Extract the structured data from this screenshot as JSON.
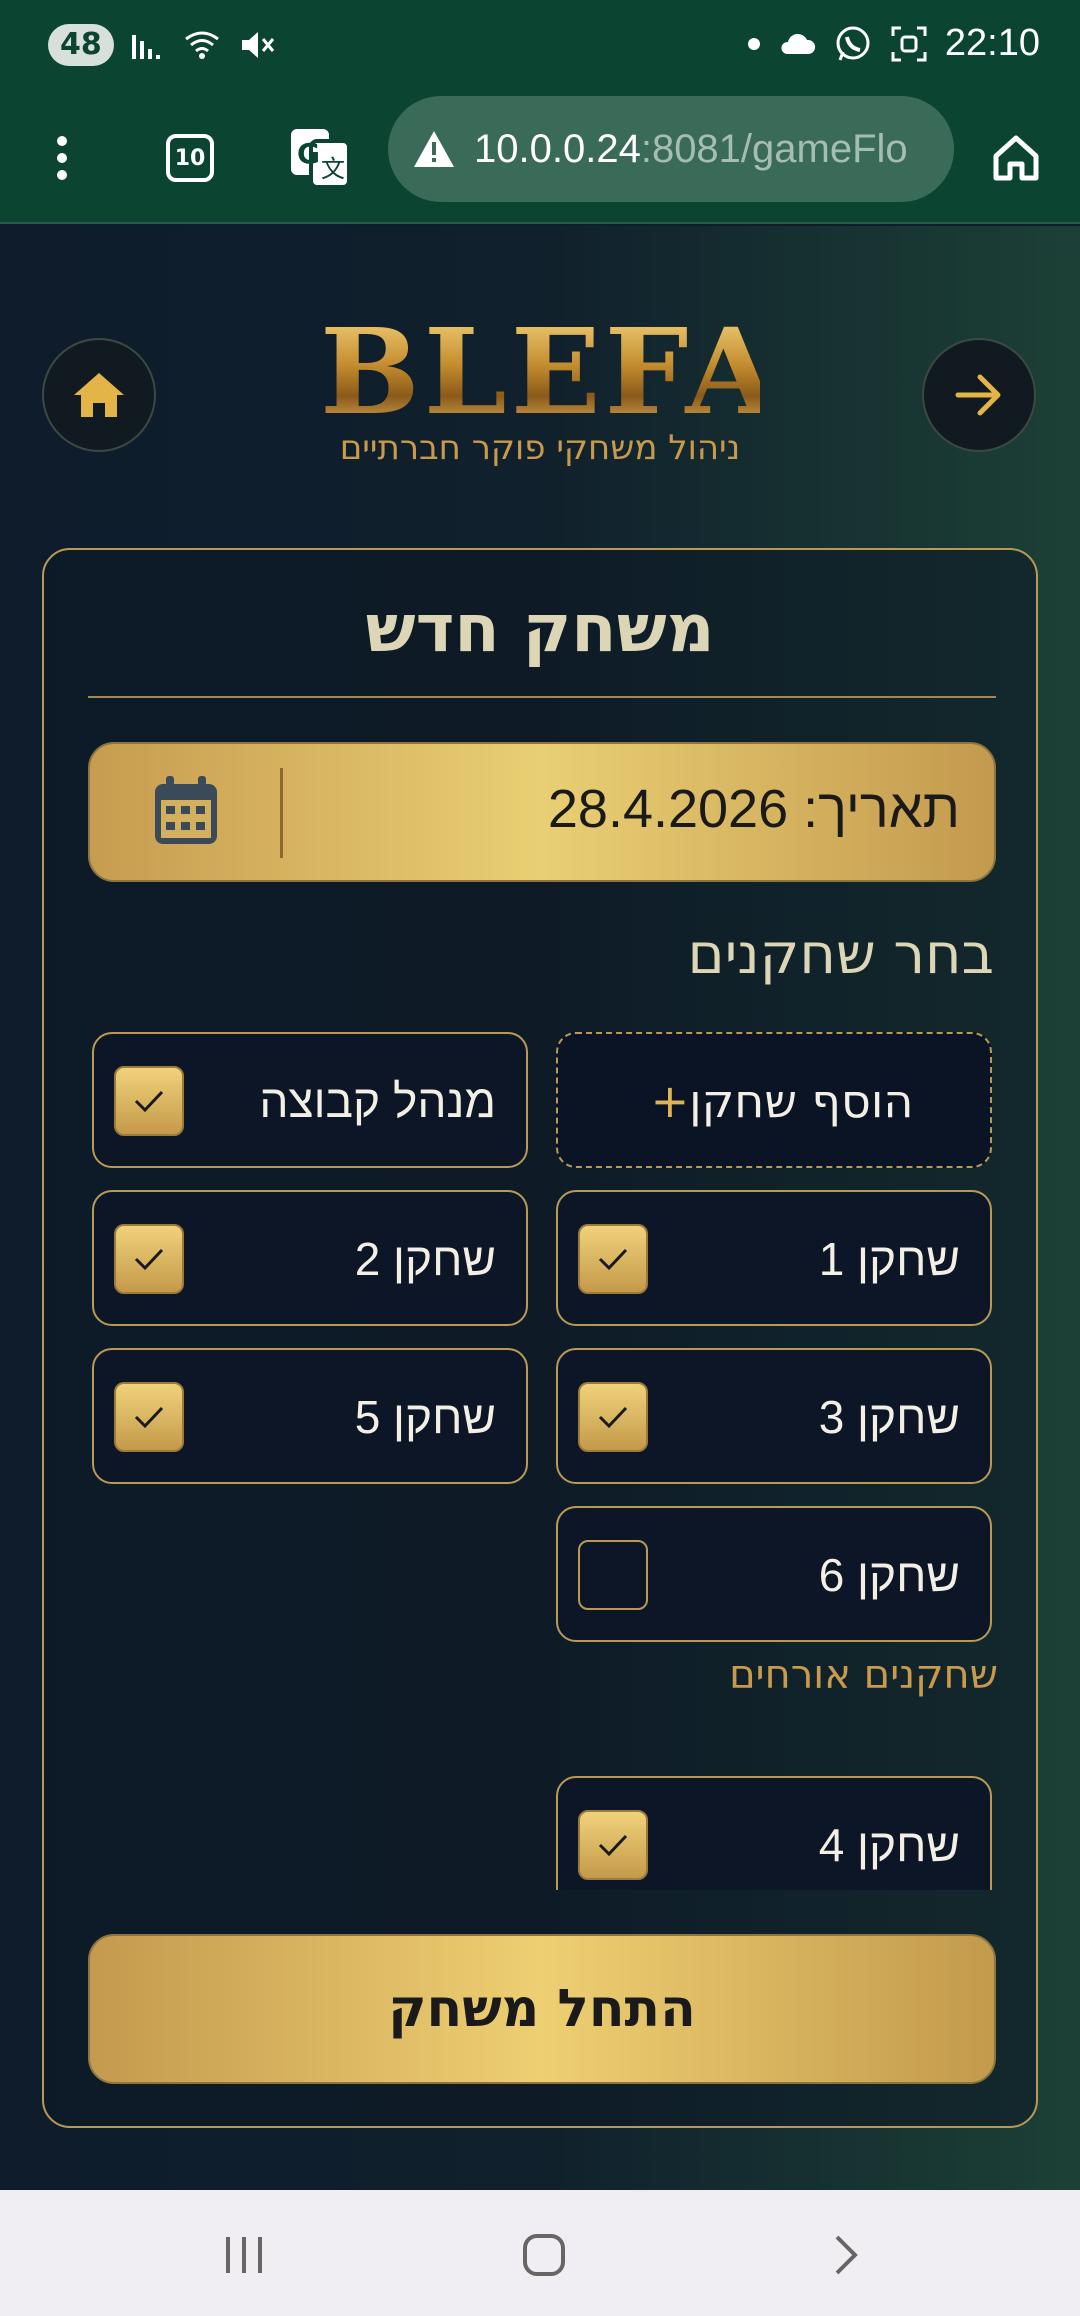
{
  "status_bar": {
    "battery": "48",
    "time": "22:10"
  },
  "browser": {
    "tabs_count": "10",
    "url_host": "10.0.0.24",
    "url_rest": ":8081/gameFlo"
  },
  "header": {
    "logo_title": "BLEFA",
    "logo_subtitle": "ניהול משחקי פוקר חברתיים"
  },
  "form": {
    "title": "משחק חדש",
    "date_label": "תאריך: 28.4.2026",
    "players_title": "בחר שחקנים",
    "add_player_label": "הוסף שחקן",
    "players": [
      {
        "label": "מנהל קבוצה",
        "checked": true
      },
      {
        "label": "שחקן 1",
        "checked": true
      },
      {
        "label": "שחקן 2",
        "checked": true
      },
      {
        "label": "שחקן 3",
        "checked": true
      },
      {
        "label": "שחקן 5",
        "checked": true
      },
      {
        "label": "שחקן 6",
        "checked": false
      }
    ],
    "guests_title": "שחקנים אורחים",
    "guests": [
      {
        "label": "שחקן 4",
        "checked": true
      }
    ],
    "start_button": "התחל משחק"
  },
  "colors": {
    "gold": "#e0b454",
    "green_bar": "#0b4431",
    "card_border": "#b89a55"
  }
}
